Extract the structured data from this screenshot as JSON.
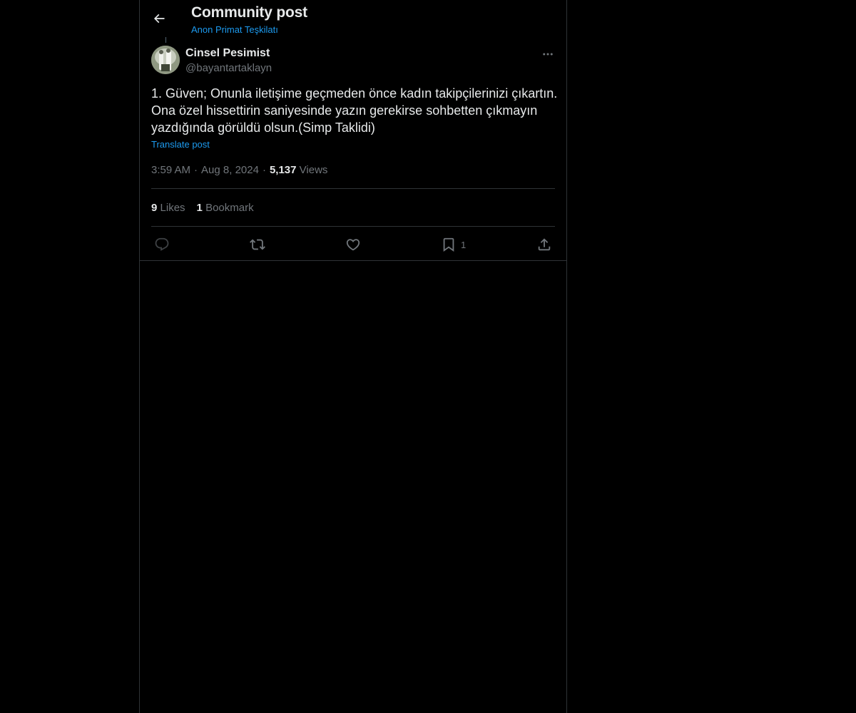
{
  "header": {
    "title": "Community post",
    "community": "Anon Primat Teşkilatı"
  },
  "post": {
    "author_name": "Cinsel Pesimist",
    "author_handle": "@bayantartaklayn",
    "text": "1. Güven; Onunla iletişime geçmeden önce kadın takipçilerinizi çıkartın.\nOna özel hissettirin saniyesinde yazın gerekirse sohbetten çıkmayın\nyazdığında görüldü olsun.(Simp Taklidi)",
    "translate_label": "Translate post",
    "time": "3:59 AM",
    "date": "Aug 8, 2024",
    "views_count": "5,137",
    "views_label": "Views",
    "likes_count": "9",
    "likes_label": "Likes",
    "bookmarks_count": "1",
    "bookmarks_label": "Bookmark"
  },
  "actions": {
    "reply_icon": "reply-icon",
    "repost_icon": "repost-icon",
    "like_icon": "heart-icon",
    "bookmark_icon": "bookmark-icon",
    "bookmark_count": "1",
    "share_icon": "share-icon"
  },
  "colors": {
    "background": "#000000",
    "accent": "#1d9bf0",
    "text_primary": "#e7e9ea",
    "text_secondary": "#71767b",
    "border": "#2f3336"
  }
}
